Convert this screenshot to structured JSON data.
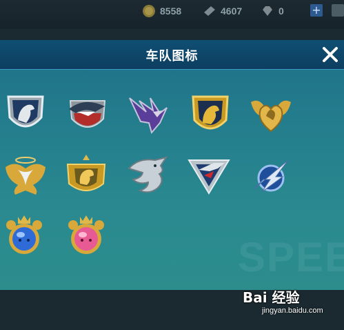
{
  "top_bar": {
    "coins": "8558",
    "gems": "4607",
    "diamonds": "0"
  },
  "dialog": {
    "title": "车队图标",
    "close_label": "✕"
  },
  "emblems": [
    {
      "icon": "silver-horse-shield-icon"
    },
    {
      "icon": "shark-shield-icon"
    },
    {
      "icon": "purple-eagle-icon"
    },
    {
      "icon": "gold-horse-shield-icon"
    },
    {
      "icon": "gold-heart-wings-icon"
    },
    {
      "icon": "gold-winged-crest-icon"
    },
    {
      "icon": "gold-lion-crest-icon"
    },
    {
      "icon": "silver-dragon-icon"
    },
    {
      "icon": "silver-eagle-triangle-icon"
    },
    {
      "icon": "blue-lightning-orb-icon"
    },
    {
      "icon": "blue-crown-orb-icon"
    },
    {
      "icon": "pink-crown-orb-icon"
    }
  ],
  "watermark": {
    "background_text": "SPEE",
    "brand": "Bai 经验",
    "url": "jingyan.baidu.com"
  }
}
